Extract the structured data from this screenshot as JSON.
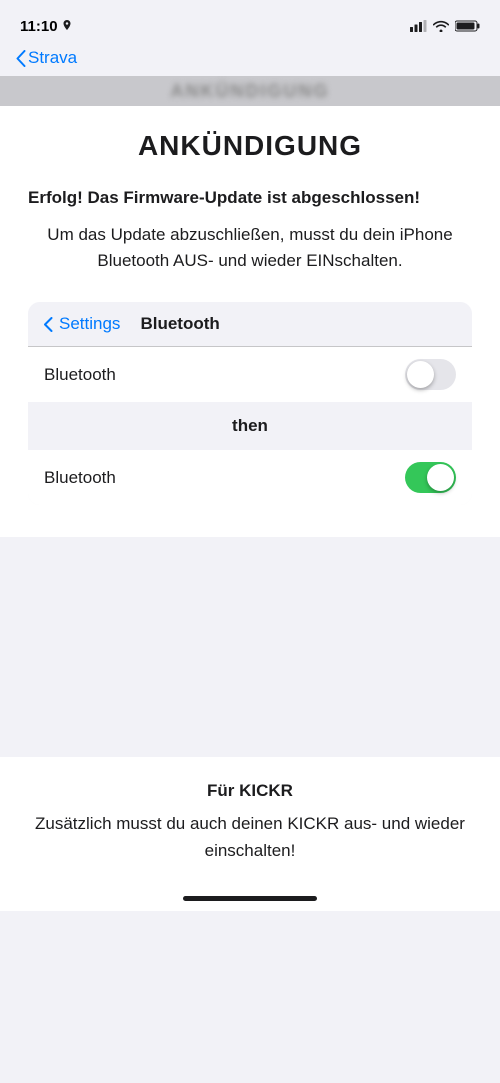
{
  "statusBar": {
    "time": "11:10",
    "locationIcon": true
  },
  "backNav": {
    "label": "Strava"
  },
  "blurredHeader": {
    "text": "··· ··· ···"
  },
  "announcement": {
    "title": "ANKÜNDIGUNG",
    "successText": "Erfolg! Das Firmware-Update ist abgeschlossen!",
    "instructionText": "Um das Update abzuschließen, musst du dein iPhone Bluetooth AUS- und wieder EINschalten."
  },
  "bluetoothCard": {
    "settingsLabel": "Settings",
    "bluetoothPageTitle": "Bluetooth",
    "bluetoothLabel1": "Bluetooth",
    "toggleOff": false,
    "thenLabel": "then",
    "bluetoothLabel2": "Bluetooth",
    "toggleOn": true
  },
  "kickrSection": {
    "title": "Für KICKR",
    "text": "Zusätzlich musst du auch deinen KICKR aus- und wieder einschalten!"
  }
}
